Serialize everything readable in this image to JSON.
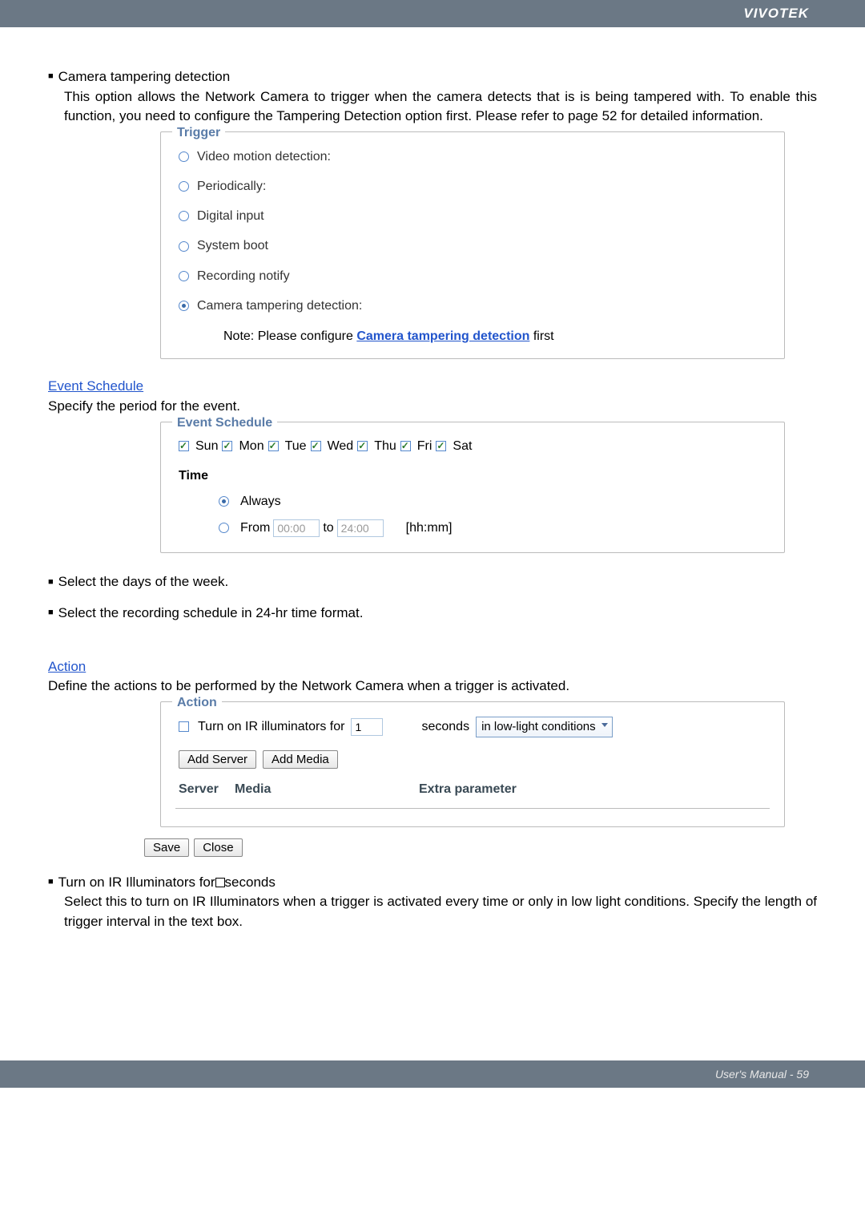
{
  "header": {
    "brand": "VIVOTEK"
  },
  "intro_title": "Camera tampering detection",
  "intro_body": "This option allows the Network Camera to trigger when the camera detects that is is being tampered with. To enable this function, you need to configure the Tampering Detection option first. Please refer to page 52 for detailed information.",
  "trigger": {
    "legend": "Trigger",
    "opts": {
      "video": "Video motion detection:",
      "periodic": "Periodically:",
      "digital": "Digital input",
      "system": "System boot",
      "recording": "Recording notify",
      "tamper": "Camera tampering detection:"
    },
    "note_prefix": "Note: Please configure ",
    "note_link": "Camera tampering detection",
    "note_suffix": " first"
  },
  "event_section": {
    "link": "Event Schedule",
    "subtitle": "Specify the period for the event.",
    "legend": "Event Schedule",
    "days": {
      "sun": "Sun",
      "mon": "Mon",
      "tue": "Tue",
      "wed": "Wed",
      "thu": "Thu",
      "fri": "Fri",
      "sat": "Sat"
    },
    "time_label": "Time",
    "always": "Always",
    "from": "From",
    "from_val": "00:00",
    "to": "to",
    "to_val": "24:00",
    "hhmm": "[hh:mm]"
  },
  "bullets": {
    "b1": "Select the days of the week.",
    "b2": "Select the recording schedule in 24-hr time format."
  },
  "action_section": {
    "link": "Action",
    "subtitle": "Define the actions to be performed by the Network Camera when a trigger is activated.",
    "legend": "Action",
    "illum_label": "Turn on IR illuminators for",
    "illum_val": "1",
    "seconds": "seconds",
    "dropdown": "in low-light conditions",
    "add_server": "Add Server",
    "add_media": "Add Media",
    "col_server": "Server",
    "col_media": "Media",
    "col_extra": "Extra parameter"
  },
  "save": "Save",
  "close": "Close",
  "bottom": {
    "title_prefix": "Turn on IR Illuminators for  ",
    "title_suffix": " seconds",
    "body": "Select this to turn on IR Illuminators when a trigger is activated every time or only in low light conditions. Specify the length of trigger interval in the text box."
  },
  "footer": "User's Manual - 59"
}
